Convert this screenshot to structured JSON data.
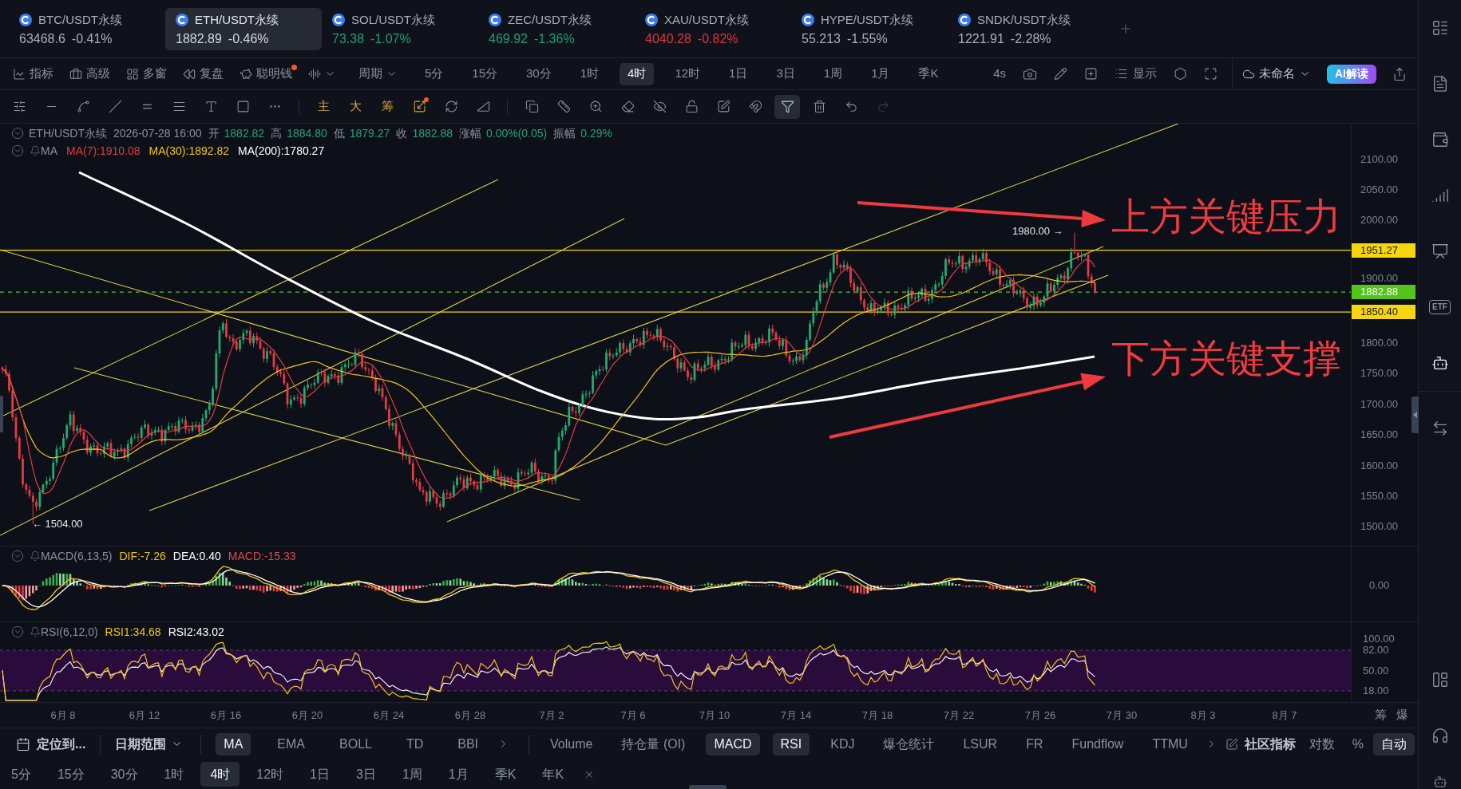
{
  "symbol_tabs": [
    {
      "name": "BTC/USDT永续",
      "price": "63468.6",
      "change": "-0.41%",
      "color": "#a9aebb",
      "selected": false
    },
    {
      "name": "ETH/USDT永续",
      "price": "1882.89",
      "change": "-0.46%",
      "color": "#d3d6de",
      "selected": true
    },
    {
      "name": "SOL/USDT永续",
      "price": "73.38",
      "change": "-1.07%",
      "color": "#1f9d74",
      "selected": false
    },
    {
      "name": "ZEC/USDT永续",
      "price": "469.92",
      "change": "-1.36%",
      "color": "#1f9d74",
      "selected": false
    },
    {
      "name": "XAU/USDT永续",
      "price": "4040.28",
      "change": "-0.82%",
      "color": "#d9363e",
      "selected": false
    },
    {
      "name": "HYPE/USDT永续",
      "price": "55.213",
      "change": "-1.55%",
      "color": "#a9aebb",
      "selected": false
    },
    {
      "name": "SNDK/USDT永续",
      "price": "1221.91",
      "change": "-2.28%",
      "color": "#a9aebb",
      "selected": false
    }
  ],
  "toolbar": {
    "menus": [
      {
        "label": "指标",
        "dot": false
      },
      {
        "label": "高级",
        "dot": false
      },
      {
        "label": "多窗",
        "dot": false
      },
      {
        "label": "复盘",
        "dot": false
      },
      {
        "label": "聪明钱",
        "dot": true
      }
    ],
    "period": "周期",
    "timeframes": [
      {
        "label": "5分",
        "selected": false
      },
      {
        "label": "15分",
        "selected": false
      },
      {
        "label": "30分",
        "selected": false
      },
      {
        "label": "1时",
        "selected": false
      },
      {
        "label": "4时",
        "selected": true
      },
      {
        "label": "12时",
        "selected": false
      },
      {
        "label": "1日",
        "selected": false
      },
      {
        "label": "3日",
        "selected": false
      },
      {
        "label": "1周",
        "selected": false
      },
      {
        "label": "1月",
        "selected": false
      },
      {
        "label": "季K",
        "selected": false
      }
    ],
    "refresh": "4s",
    "display": "显示",
    "layout_name": "未命名",
    "ai_button": "AI解读"
  },
  "drawing_toolbar": {
    "text_tools": [
      "主",
      "大",
      "筹"
    ],
    "measure_dot": true,
    "filter_active": true,
    "redo_disabled": true
  },
  "ohlc_info": {
    "symbol": "ETH/USDT永续",
    "time": "2026-07-28 16:00",
    "fields": [
      {
        "label": "开",
        "value": "1882.82"
      },
      {
        "label": "高",
        "value": "1884.80"
      },
      {
        "label": "低",
        "value": "1879.27"
      },
      {
        "label": "收",
        "value": "1882.88"
      },
      {
        "label": "涨幅",
        "value": "0.00%(0.05)"
      },
      {
        "label": "振幅",
        "value": "0.29%"
      }
    ]
  },
  "ma_legend": {
    "label": "MA",
    "items": [
      {
        "text": "MA(7):1910.08",
        "color": "#e23b44"
      },
      {
        "text": "MA(30):1892.82",
        "color": "#f2c318"
      },
      {
        "text": "MA(200):1780.27",
        "color": "#ffffff"
      }
    ]
  },
  "price_chart": {
    "price_axis": [
      "2100.00",
      "2050.00",
      "2000.00",
      "1900.00",
      "1800.00",
      "1750.00",
      "1700.00",
      "1650.00",
      "1600.00",
      "1550.00",
      "1500.00"
    ],
    "price_tags": [
      {
        "value": "1951.27",
        "kind": "line",
        "color": "#f5d60f"
      },
      {
        "value": "1882.88",
        "kind": "last",
        "color": "#52c41a"
      },
      {
        "value": "1850.40",
        "kind": "line",
        "color": "#f5d60f"
      }
    ],
    "high_label": "1980.00 →",
    "low_label": "← 1504.00",
    "annotations": [
      "上方关键压力",
      "下方关键支撑"
    ]
  },
  "macd": {
    "label": "MACD(6,13,5)",
    "values": [
      {
        "text": "DIF:-7.26",
        "color": "#f2c318"
      },
      {
        "text": "DEA:0.40",
        "color": "#ffffff"
      },
      {
        "text": "MACD:-15.33",
        "color": "#e0474f"
      }
    ],
    "axis": [
      "0.00"
    ]
  },
  "rsi": {
    "label": "RSI(6,12,0)",
    "values": [
      {
        "text": "RSI1:34.68",
        "color": "#f2c318"
      },
      {
        "text": "RSI2:43.02",
        "color": "#ffffff"
      }
    ],
    "axis": [
      "100.00",
      "82.00",
      "50.00",
      "18.00"
    ]
  },
  "time_axis": {
    "labels": [
      "6月 8",
      "6月 12",
      "6月 16",
      "6月 20",
      "6月 24",
      "6月 28",
      "7月 2",
      "7月 6",
      "7月 10",
      "7月 14",
      "7月 18",
      "7月 22",
      "7月 26",
      "7月 30",
      "8月 3",
      "8月 7"
    ],
    "buttons": [
      "筹",
      "爆"
    ]
  },
  "indicator_bar": {
    "locate": "定位到...",
    "date_range": "日期范围",
    "main": [
      {
        "label": "MA",
        "selected": true
      },
      {
        "label": "EMA",
        "selected": false
      },
      {
        "label": "BOLL",
        "selected": false
      },
      {
        "label": "TD",
        "selected": false
      },
      {
        "label": "BBI",
        "selected": false
      }
    ],
    "sub": [
      {
        "label": "Volume",
        "selected": false
      },
      {
        "label": "持仓量 (OI)",
        "selected": false
      },
      {
        "label": "MACD",
        "selected": true
      },
      {
        "label": "RSI",
        "selected": true
      },
      {
        "label": "KDJ",
        "selected": false
      },
      {
        "label": "爆仓统计",
        "selected": false
      },
      {
        "label": "LSUR",
        "selected": false
      },
      {
        "label": "FR",
        "selected": false
      },
      {
        "label": "Fundflow",
        "selected": false
      },
      {
        "label": "TTMU",
        "selected": false
      }
    ],
    "community": "社区指标",
    "scale": [
      {
        "label": "对数",
        "selected": false
      },
      {
        "label": "%",
        "selected": false
      },
      {
        "label": "自动",
        "selected": true
      }
    ]
  },
  "quick_timeframes": [
    {
      "label": "5分",
      "selected": false
    },
    {
      "label": "15分",
      "selected": false
    },
    {
      "label": "30分",
      "selected": false
    },
    {
      "label": "1时",
      "selected": false
    },
    {
      "label": "4时",
      "selected": true
    },
    {
      "label": "12时",
      "selected": false
    },
    {
      "label": "1日",
      "selected": false
    },
    {
      "label": "3日",
      "selected": false
    },
    {
      "label": "1周",
      "selected": false
    },
    {
      "label": "1月",
      "selected": false
    },
    {
      "label": "季K",
      "selected": false
    },
    {
      "label": "年K",
      "selected": false
    }
  ],
  "sidebar": {
    "items": [
      {
        "selected": false
      },
      {
        "selected": false
      },
      {
        "selected": false
      },
      {
        "selected": false
      },
      {
        "selected": false
      },
      {
        "selected": false,
        "label": "ETF"
      },
      {
        "selected": true
      },
      {
        "selected": false
      },
      {
        "selected": false
      },
      {
        "selected": false
      },
      {
        "selected": false
      }
    ]
  }
}
